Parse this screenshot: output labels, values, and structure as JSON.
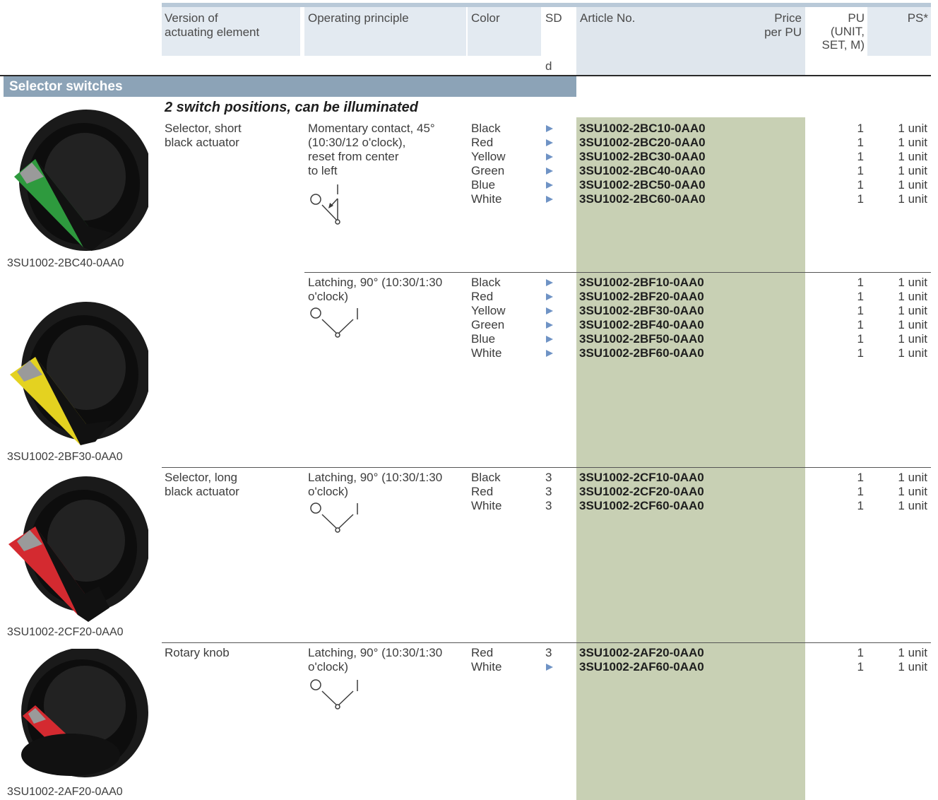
{
  "header": {
    "version": "Version of\nactuating element",
    "principle": "Operating principle",
    "color": "Color",
    "sd": "SD",
    "sd_unit": "d",
    "article": "Article No.",
    "price": "Price\nper PU",
    "pu": "PU\n(UNIT,\nSET, M)",
    "ps": "PS*"
  },
  "section": {
    "title": "Selector switches",
    "subtitle": "2 switch positions, can be illuminated"
  },
  "colors": {
    "header_bg": "#e3eaf1",
    "header_top_bar": "#b9c9d8",
    "section_bg": "#8ca3b7",
    "article_bg": "#c8d0b4",
    "arrow": "#6f93c5"
  },
  "groups": [
    {
      "image_caption": "3SU1002-2BC40-0AA0",
      "version": "Selector, short\nblack actuator",
      "principle": "Momentary contact, 45°\n(10:30/12 o'clock),\nreset from center\nto left",
      "colors": "Black\nRed\nYellow\nGreen\nBlue\nWhite",
      "sd": [
        "arrow",
        "arrow",
        "arrow",
        "arrow",
        "arrow",
        "arrow"
      ],
      "articles": "3SU1002-2BC10-0AA0\n3SU1002-2BC20-0AA0\n3SU1002-2BC30-0AA0\n3SU1002-2BC40-0AA0\n3SU1002-2BC50-0AA0\n3SU1002-2BC60-0AA0",
      "pu": "1\n1\n1\n1\n1\n1",
      "ps": "1 unit\n1 unit\n1 unit\n1 unit\n1 unit\n1 unit"
    },
    {
      "image_caption": "3SU1002-2BF30-0AA0",
      "version": "",
      "principle": "Latching, 90° (10:30/1:30\no'clock)",
      "colors": "Black\nRed\nYellow\nGreen\nBlue\nWhite",
      "sd": [
        "arrow",
        "arrow",
        "arrow",
        "arrow",
        "arrow",
        "arrow"
      ],
      "articles": "3SU1002-2BF10-0AA0\n3SU1002-2BF20-0AA0\n3SU1002-2BF30-0AA0\n3SU1002-2BF40-0AA0\n3SU1002-2BF50-0AA0\n3SU1002-2BF60-0AA0",
      "pu": "1\n1\n1\n1\n1\n1",
      "ps": "1 unit\n1 unit\n1 unit\n1 unit\n1 unit\n1 unit"
    },
    {
      "image_caption": "3SU1002-2CF20-0AA0",
      "version": "Selector, long\nblack actuator",
      "principle": "Latching, 90° (10:30/1:30\no'clock)",
      "colors": "Black\nRed\nWhite",
      "sd_text": "3\n3\n3",
      "articles": "3SU1002-2CF10-0AA0\n3SU1002-2CF20-0AA0\n3SU1002-2CF60-0AA0",
      "pu": "1\n1\n1",
      "ps": "1 unit\n1 unit\n1 unit"
    },
    {
      "image_caption": "3SU1002-2AF20-0AA0",
      "version": "Rotary knob",
      "principle": "Latching, 90° (10:30/1:30\no'clock)",
      "colors": "Red\nWhite",
      "sd_mixed": "3",
      "articles": "3SU1002-2AF20-0AA0\n3SU1002-2AF60-0AA0",
      "pu": "1\n1",
      "ps": "1 unit\n1 unit"
    }
  ],
  "symbols": {
    "off": "O",
    "on": "I"
  }
}
